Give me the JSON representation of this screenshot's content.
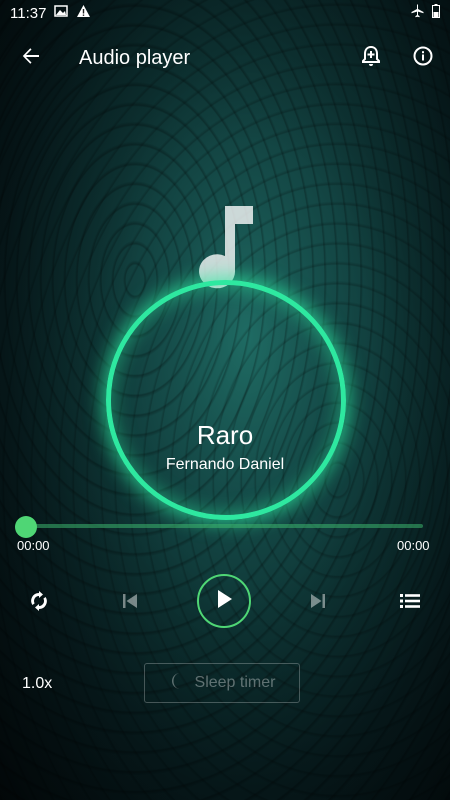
{
  "status_bar": {
    "time": "11:37",
    "icons": [
      "image-icon",
      "warning-icon",
      "airplane-icon",
      "battery-icon"
    ]
  },
  "app_bar": {
    "title": "Audio player",
    "icons": [
      "back-arrow-icon",
      "alarm-add-icon",
      "info-icon"
    ]
  },
  "track": {
    "title": "Raro",
    "artist": "Fernando Daniel",
    "progress": 0
  },
  "seek": {
    "current_time": "00:00",
    "total_time": "00:00"
  },
  "controls": {
    "icons": [
      "repeat-icon",
      "skip-previous-icon",
      "play-icon",
      "skip-next-icon",
      "playlist-icon"
    ]
  },
  "bottom": {
    "speed": "1.0x",
    "sleep_timer_label": "Sleep timer"
  },
  "colors": {
    "accent_green": "#4fd675",
    "ring_glow": "#2ee8a0",
    "background_teal": "#164e4b"
  }
}
